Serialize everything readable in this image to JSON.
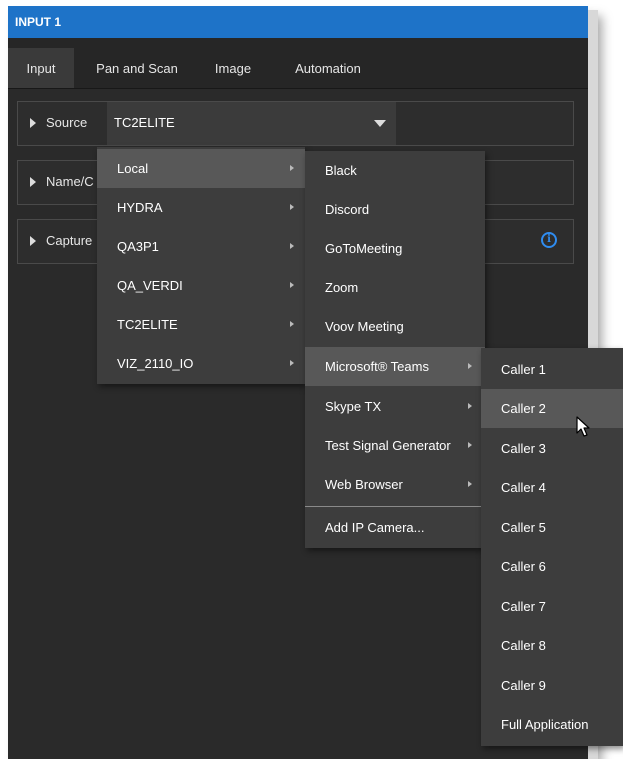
{
  "window": {
    "title": "INPUT 1"
  },
  "tabs": [
    {
      "label": "Input",
      "active": true
    },
    {
      "label": "Pan and Scan",
      "active": false
    },
    {
      "label": "Image",
      "active": false
    },
    {
      "label": "Automation",
      "active": false
    }
  ],
  "rows": {
    "source": {
      "label": "Source",
      "value": "TC2ELITE"
    },
    "name": {
      "label": "Name/C"
    },
    "capture": {
      "label": "Capture"
    }
  },
  "menu1": {
    "items": [
      {
        "label": "Local",
        "highlighted": true
      },
      {
        "label": "HYDRA"
      },
      {
        "label": "QA3P1"
      },
      {
        "label": "QA_VERDI"
      },
      {
        "label": "TC2ELITE"
      },
      {
        "label": "VIZ_2110_IO"
      }
    ]
  },
  "menu2": {
    "items": [
      {
        "label": "Black"
      },
      {
        "label": "Discord"
      },
      {
        "label": "GoToMeeting"
      },
      {
        "label": "Zoom"
      },
      {
        "label": "Voov Meeting"
      },
      {
        "label": "Microsoft® Teams",
        "highlighted": true
      },
      {
        "label": "Skype TX"
      },
      {
        "label": "Test Signal Generator"
      },
      {
        "label": "Web Browser"
      },
      {
        "label": "Add IP Camera..."
      }
    ]
  },
  "menu3": {
    "items": [
      {
        "label": "Caller 1"
      },
      {
        "label": "Caller 2",
        "highlighted": true
      },
      {
        "label": "Caller 3"
      },
      {
        "label": "Caller 4"
      },
      {
        "label": "Caller 5"
      },
      {
        "label": "Caller 6"
      },
      {
        "label": "Caller 7"
      },
      {
        "label": "Caller 8"
      },
      {
        "label": "Caller 9"
      },
      {
        "label": "Full Application"
      }
    ]
  },
  "colors": {
    "titlebar": "#1e73c8",
    "panel": "#2a2a2a",
    "menu": "#3d3d3d",
    "highlight": "#585858",
    "info": "#2f8cf0"
  },
  "icons": {
    "info": "info-circle-icon",
    "expand": "triangle-right-icon",
    "dropdown": "caret-down-icon",
    "submenu": "submenu-arrow-icon",
    "cursor": "mouse-pointer-icon"
  }
}
